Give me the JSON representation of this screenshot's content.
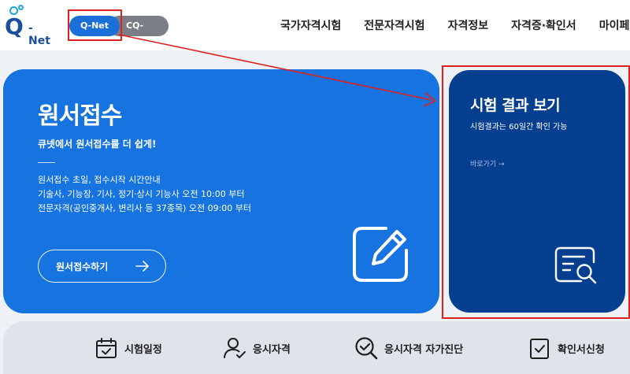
{
  "header": {
    "logo_text": "- Net",
    "logo_letter": "Q",
    "toggle": {
      "qnet_label": "Q-Net",
      "cqnet_label": "CQ-Net"
    },
    "nav": [
      "국가자격시험",
      "전문자격시험",
      "자격정보",
      "자격증·확인서",
      "마이페이지"
    ]
  },
  "apply_card": {
    "title": "원서접수",
    "subtitle": "큐넷에서 원서접수를 더 쉽게!",
    "notes": [
      "원서접수 초일, 접수시작 시간안내",
      "기술사, 기능장, 기사, 정기·상시 기능사 오전 10:00 부터",
      "전문자격(공인중개사, 변리사 등 37종목) 오전 09:00 부터"
    ],
    "button_label": "원서접수하기",
    "icon": "edit-document-icon"
  },
  "result_card": {
    "title": "시험 결과 보기",
    "subtitle": "시험결과는 60일간 확인 가능",
    "link_label": "바로가기 →",
    "icon": "document-search-icon"
  },
  "quick_menu": [
    {
      "label": "시험일정",
      "icon": "calendar-check-icon"
    },
    {
      "label": "응시자격",
      "icon": "user-check-icon"
    },
    {
      "label": "응시자격 자가진단",
      "icon": "magnifier-check-icon"
    },
    {
      "label": "확인서신청",
      "icon": "clipboard-check-icon"
    }
  ],
  "colors": {
    "apply_card": "#1673e0",
    "result_card": "#063f8f",
    "qnet_toggle": "#1b6fd8",
    "cqnet_toggle": "#7a7f87",
    "annotation": "#e02020"
  }
}
